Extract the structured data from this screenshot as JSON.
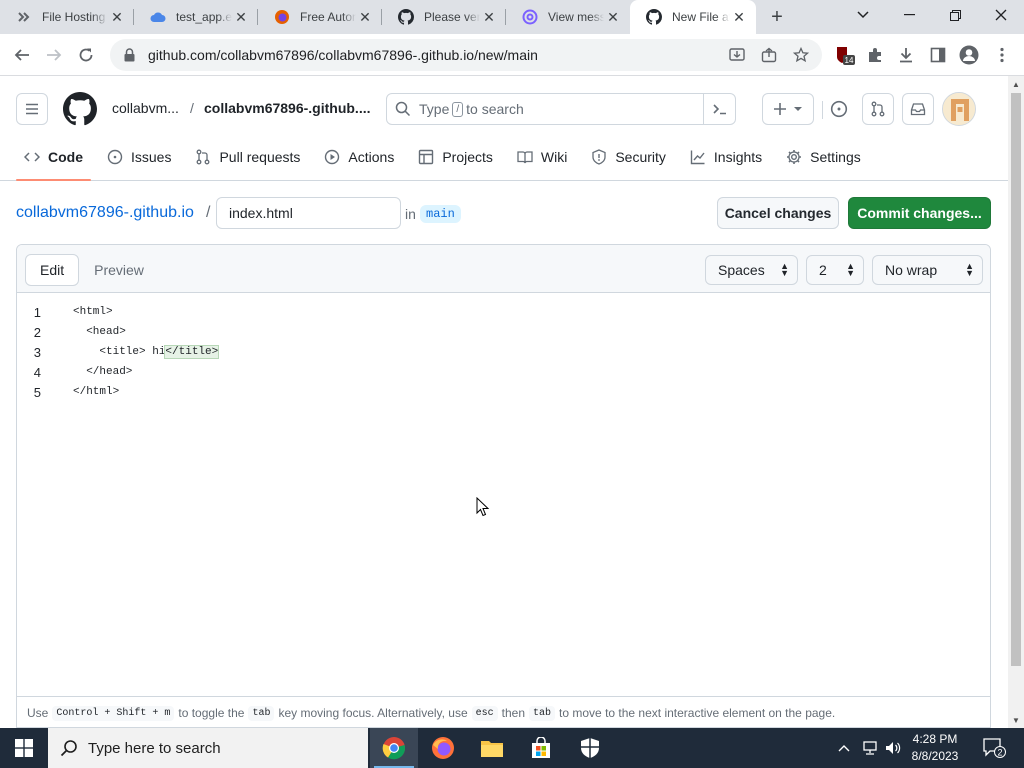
{
  "browser": {
    "tabs": [
      {
        "label": "File Hosting",
        "icon": "file-hosting-icon"
      },
      {
        "label": "test_app.exe",
        "icon": "cloud-icon"
      },
      {
        "label": "Free Autom",
        "icon": "firefox-icon"
      },
      {
        "label": "Please verif",
        "icon": "github-icon"
      },
      {
        "label": "View messa",
        "icon": "at-sign-icon"
      },
      {
        "label": "New File at",
        "icon": "github-icon",
        "active": true
      }
    ],
    "url": "github.com/collabvm67896/collabvm67896-.github.io/new/main",
    "extension_badge": "14"
  },
  "github": {
    "owner_crumb": "collabvm...",
    "crumb_separator": "/",
    "repo_crumb": "collabvm67896-.github....",
    "search": {
      "prefix": "Type",
      "key": "/",
      "suffix": "to search"
    },
    "nav": [
      {
        "label": "Code",
        "icon": "code-icon",
        "selected": true
      },
      {
        "label": "Issues",
        "icon": "issue-icon"
      },
      {
        "label": "Pull requests",
        "icon": "pull-request-icon"
      },
      {
        "label": "Actions",
        "icon": "play-icon"
      },
      {
        "label": "Projects",
        "icon": "table-icon"
      },
      {
        "label": "Wiki",
        "icon": "book-icon"
      },
      {
        "label": "Security",
        "icon": "shield-icon"
      },
      {
        "label": "Insights",
        "icon": "graph-icon"
      },
      {
        "label": "Settings",
        "icon": "gear-icon"
      }
    ]
  },
  "pathbar": {
    "repo_link": "collabvm67896-.github.io",
    "slash": "/",
    "filename": "index.html",
    "in_word": "in",
    "branch": "main",
    "cancel_label": "Cancel changes",
    "commit_label": "Commit changes..."
  },
  "editor": {
    "tabs": {
      "edit": "Edit",
      "preview": "Preview"
    },
    "indent_mode": "Spaces",
    "indent_size": "2",
    "wrap_mode": "No wrap",
    "lines": [
      {
        "num": "1",
        "pre": "<html>",
        "hl": "",
        "post": ""
      },
      {
        "num": "2",
        "pre": "  <head>",
        "hl": "",
        "post": ""
      },
      {
        "num": "3",
        "pre": "    <title> hi",
        "hl": "</title>",
        "post": ""
      },
      {
        "num": "4",
        "pre": "  </head>",
        "hl": "",
        "post": ""
      },
      {
        "num": "5",
        "pre": "</html>",
        "hl": "",
        "post": ""
      }
    ],
    "footer": {
      "t1": "Use",
      "k1": "Control + Shift + m",
      "t2": "to toggle the",
      "k2": "tab",
      "t3": "key moving focus. Alternatively, use",
      "k3": "esc",
      "t4": "then",
      "k4": "tab",
      "t5": "to move to the next interactive element on the page."
    }
  },
  "taskbar": {
    "search_placeholder": "Type here to search",
    "time": "4:28 PM",
    "date": "8/8/2023",
    "notification_count": "2"
  },
  "colors": {
    "accent_blue": "#0969da",
    "commit_green": "#1f883d",
    "nav_underline": "#fd8c73",
    "taskbar": "#1f2b3a"
  }
}
